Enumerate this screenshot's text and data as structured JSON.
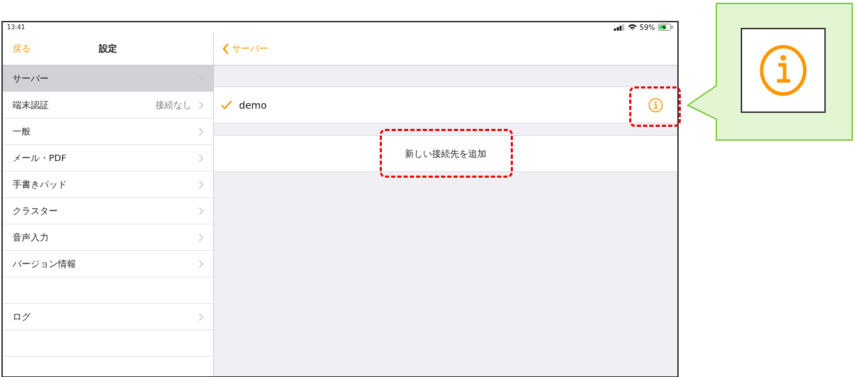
{
  "status_bar": {
    "time": "13:41",
    "battery": "59%"
  },
  "sidebar": {
    "back": "戻る",
    "title": "設定",
    "groups": [
      [
        {
          "label": "サーバー",
          "selected": true
        },
        {
          "label": "端末認証",
          "value": "接続なし",
          "selected": false
        },
        {
          "label": "一般",
          "selected": false
        },
        {
          "label": "メール・PDF",
          "selected": false
        },
        {
          "label": "手書きパッド",
          "selected": false
        },
        {
          "label": "クラスター",
          "selected": false
        },
        {
          "label": "音声入力",
          "selected": false
        },
        {
          "label": "バージョン情報",
          "selected": false
        }
      ],
      [
        {
          "label": "ログ",
          "selected": false
        }
      ]
    ]
  },
  "detail": {
    "back": "サーバー",
    "servers": [
      {
        "name": "demo",
        "checked": true
      }
    ],
    "add_button": "新しい接続先を追加"
  }
}
